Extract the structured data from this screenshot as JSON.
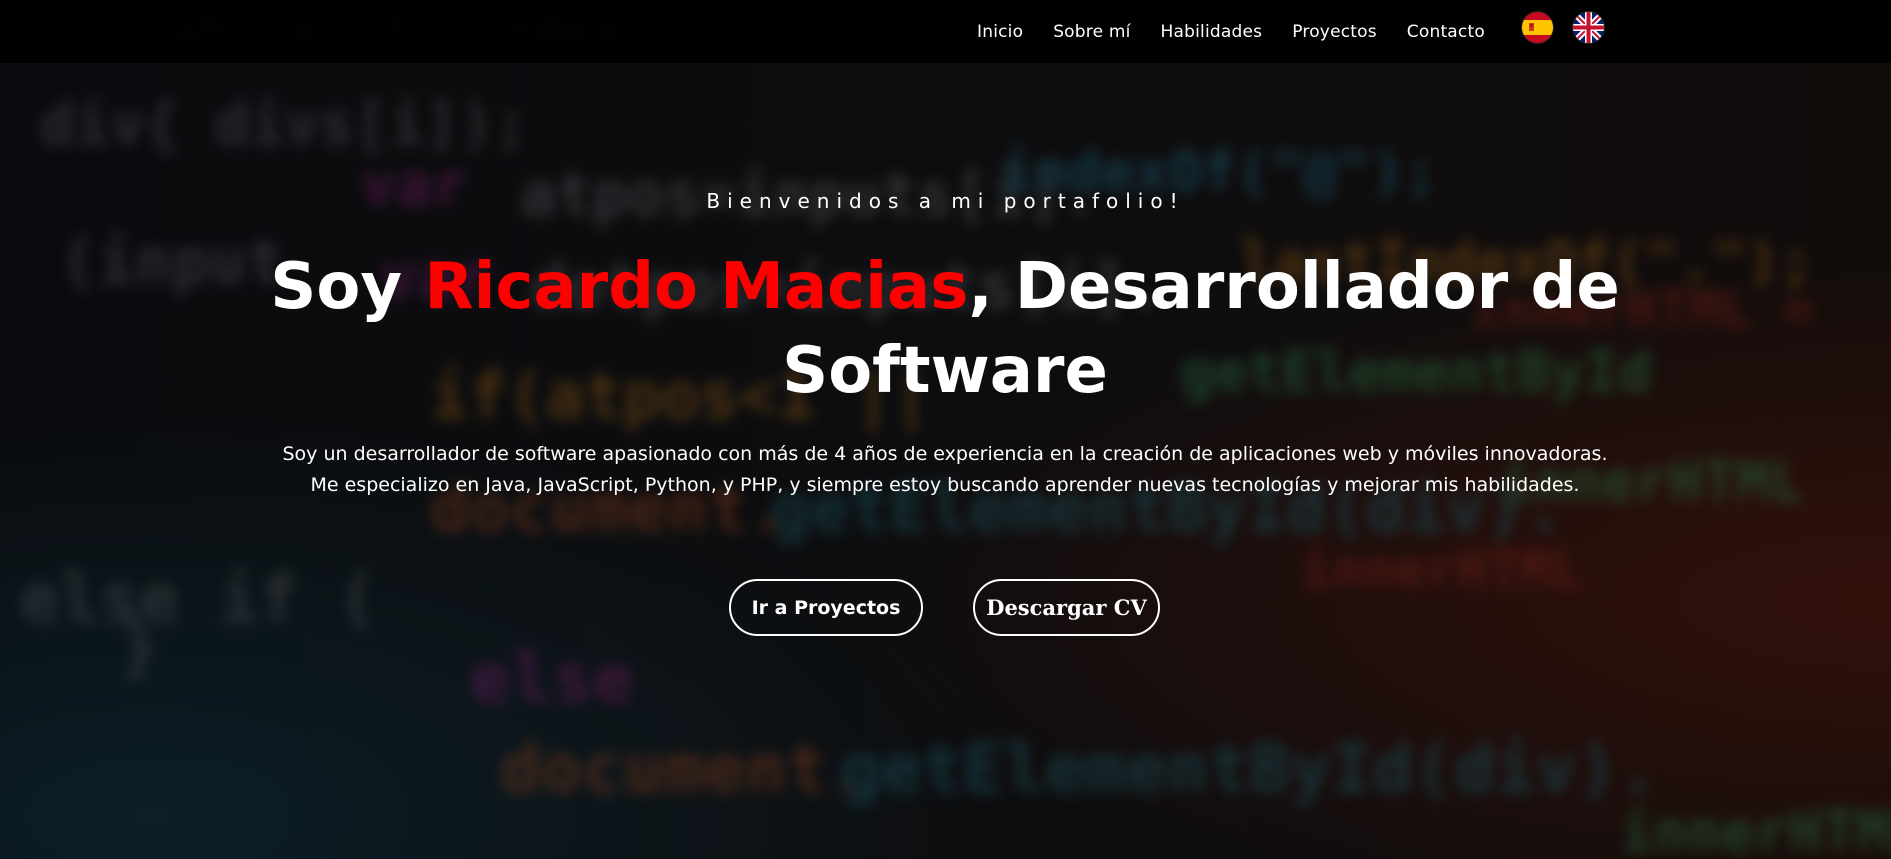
{
  "nav": {
    "links": [
      "Inicio",
      "Sobre mí",
      "Habilidades",
      "Proyectos",
      "Contacto"
    ],
    "flags": [
      "spain-flag-icon",
      "uk-flag-icon"
    ]
  },
  "hero": {
    "welcome": "Bienvenidos a mi portafolio!",
    "title_prefix": "Soy ",
    "title_name": "Ricardo Macias",
    "title_suffix": ", Desarrollador de Software",
    "intro_line1": "Soy un desarrollador de software apasionado con más de 4 años de experiencia en la creación de aplicaciones web y móviles innovadoras.",
    "intro_line2": "Me especializo en Java, JavaScript, Python, y PHP, y siempre estoy buscando aprender nuevas tecnologías y mejorar mis habilidades.",
    "btn_projects": "Ir a Proyectos",
    "btn_cv": "Descargar CV"
  },
  "colors": {
    "accent": "#ff0000",
    "text": "#ffffff",
    "nav_bg": "#000000"
  }
}
